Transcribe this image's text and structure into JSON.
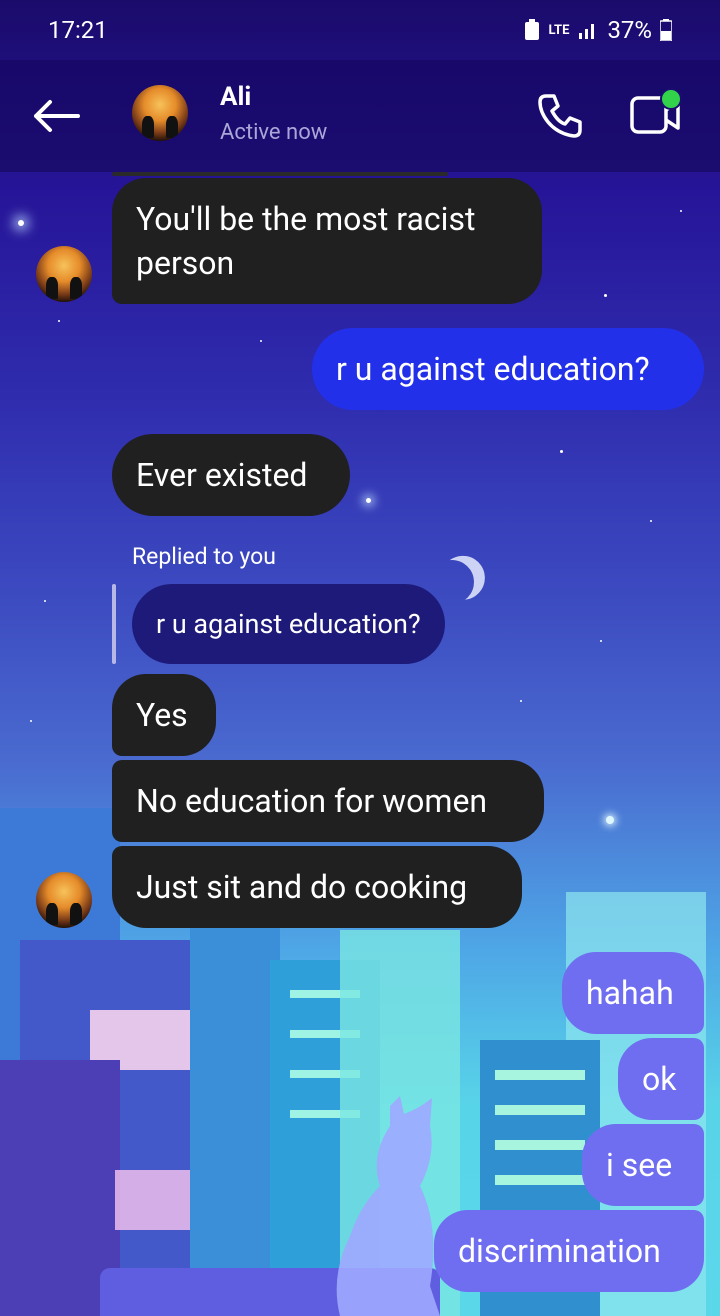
{
  "status_bar": {
    "time": "17:21",
    "network": "LTE",
    "battery": "37%"
  },
  "header": {
    "contact_name": "Ali",
    "contact_status": "Active now"
  },
  "messages": [
    {
      "direction": "incoming",
      "text_line1": "You'll be the most racist",
      "text_line2": "person"
    },
    {
      "direction": "outgoing",
      "text": "r u against education?"
    },
    {
      "direction": "incoming",
      "text": "Ever existed"
    },
    {
      "direction": "incoming",
      "reply_label": "Replied to you",
      "quoted": "r u against education?",
      "text": "Yes"
    },
    {
      "direction": "incoming",
      "text": "No education for women"
    },
    {
      "direction": "incoming",
      "text": "Just sit and do cooking"
    },
    {
      "direction": "outgoing",
      "text": "hahah"
    },
    {
      "direction": "outgoing",
      "text": "ok"
    },
    {
      "direction": "outgoing",
      "text": "i see"
    },
    {
      "direction": "outgoing",
      "text": "discrimination"
    }
  ],
  "icons": [
    "back-arrow-icon",
    "phone-icon",
    "video-camera-icon",
    "battery-icon",
    "signal-icon"
  ],
  "colors": {
    "incoming_bubble": "#202020",
    "outgoing_bubble": "#6f6ef0",
    "outgoing_bubble_highlight": "#2330ea",
    "header": "#1b0c70",
    "online": "#32d34b"
  }
}
